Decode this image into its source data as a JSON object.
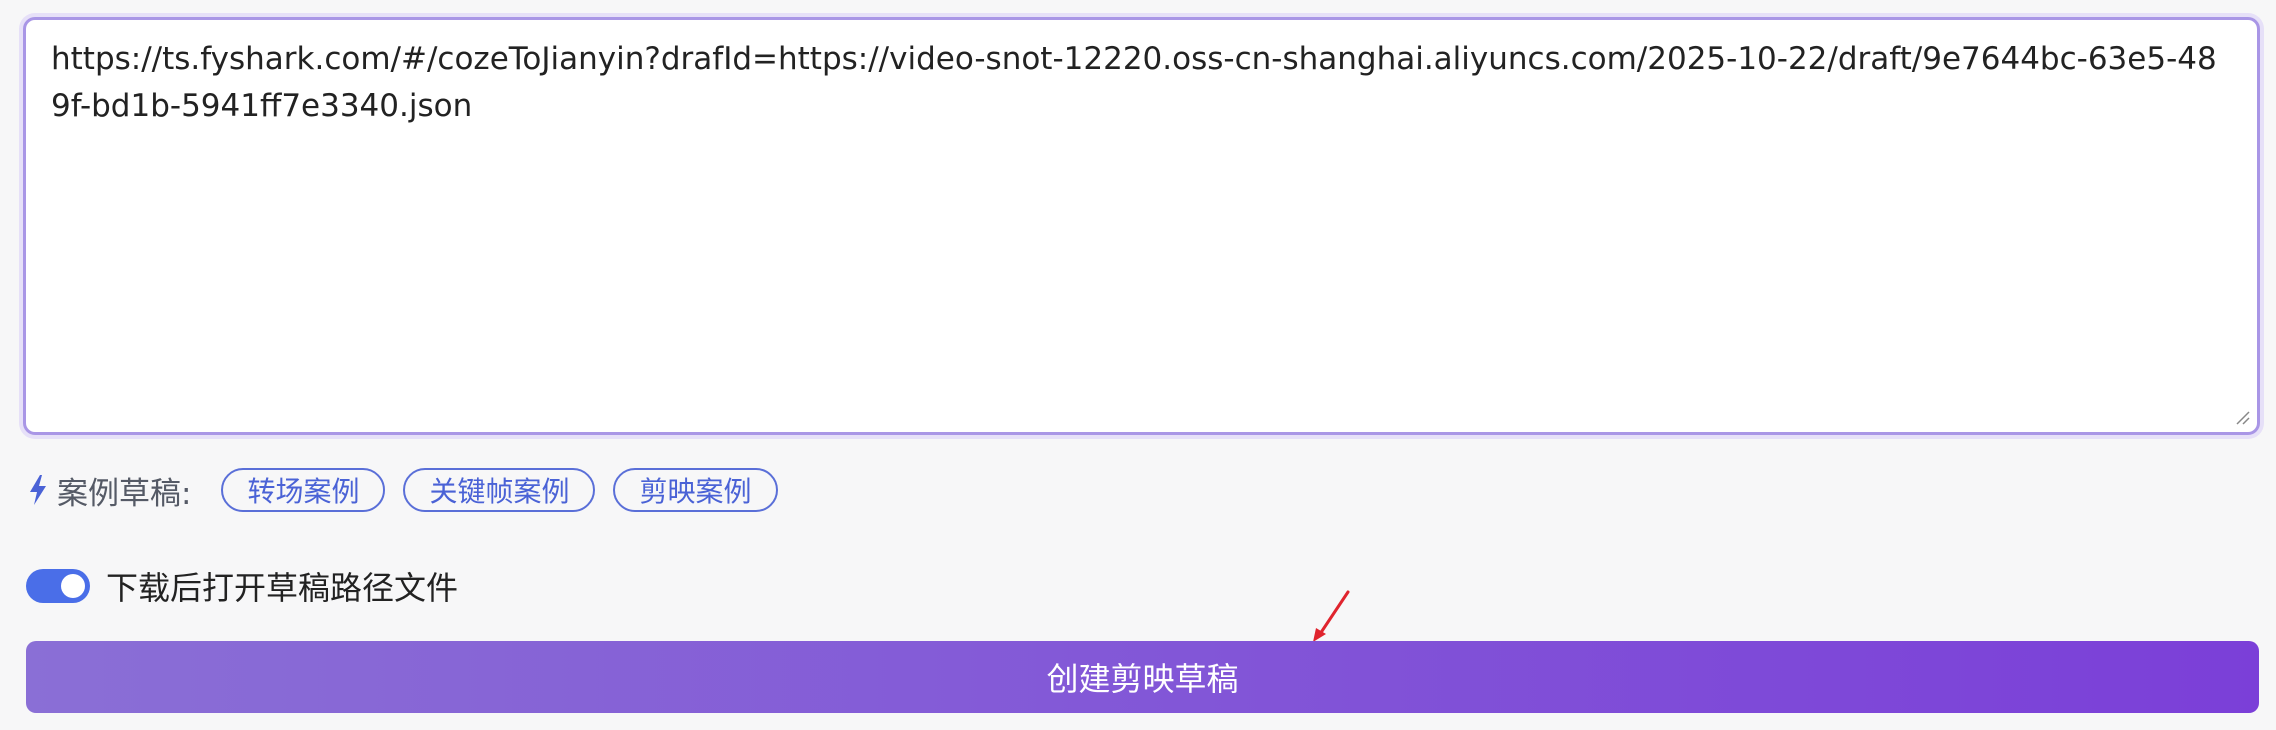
{
  "editor": {
    "value": "https://ts.fyshark.com/#/cozeToJianyin?drafId=https://video-snot-12220.oss-cn-shanghai.aliyuncs.com/2025-10-22/draft/9e7644bc-63e5-489f-bd1b-5941ff7e3340.json"
  },
  "examples": {
    "label": "案例草稿:",
    "icon": "lightning-bolt-icon",
    "chips": [
      {
        "label": "转场案例"
      },
      {
        "label": "关键帧案例"
      },
      {
        "label": "剪映案例"
      }
    ]
  },
  "toggle": {
    "label": "下载后打开草稿路径文件",
    "on": true
  },
  "actions": {
    "create_label": "创建剪映草稿"
  },
  "colors": {
    "accent": "#4a62d6",
    "toggle_on": "#4a6ee8",
    "button_start": "#8a6fd6",
    "button_end": "#7b3fd8",
    "textarea_border": "#a996e6",
    "annotation_arrow": "#e0242e"
  }
}
